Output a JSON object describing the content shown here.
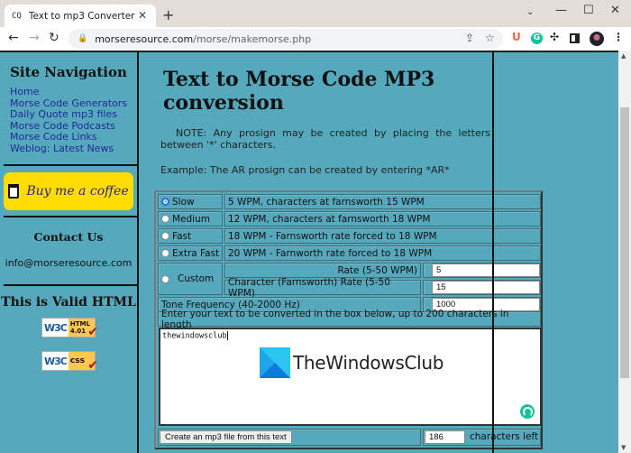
{
  "browser": {
    "tab_title": "Text to mp3 Converter",
    "tab_favicon": "CQ",
    "url_host": "morseresource.com",
    "url_path": "/morse/makemorse.php",
    "extensions": [
      "U",
      "G"
    ]
  },
  "sidebar": {
    "nav_heading": "Site Navigation",
    "nav_links": [
      {
        "label": "Home"
      },
      {
        "label": "Morse Code Generators"
      },
      {
        "label": "Daily Quote mp3 files"
      },
      {
        "label": "Morse Code Podcasts"
      },
      {
        "label": "Morse Code Links"
      },
      {
        "label": "Weblog: Latest News"
      }
    ],
    "coffee_label": "Buy me a coffee",
    "contact_heading": "Contact Us",
    "contact_email": "info@morseresource.com",
    "valid_heading": "This is Valid HTML",
    "badges": [
      {
        "w3": "W3C",
        "label": "HTML 4.01"
      },
      {
        "w3": "W3C",
        "label": "css"
      }
    ]
  },
  "main": {
    "title": "Text to Morse Code MP3 conversion",
    "note": "NOTE: Any prosign may be created by placing the letters between '*' characters.",
    "example": "Example: The AR prosign can be created by entering *AR*",
    "speeds": [
      {
        "label": "Slow",
        "desc": "5 WPM, characters at farnsworth 15 WPM",
        "selected": true
      },
      {
        "label": "Medium",
        "desc": "12 WPM, characters at farnsworth 18 WPM",
        "selected": false
      },
      {
        "label": "Fast",
        "desc": "18 WPM - Farnsworth rate forced to 18 WPM",
        "selected": false
      },
      {
        "label": "Extra Fast",
        "desc": "20 WPM - Farnworth rate forced to 18 WPM",
        "selected": false
      }
    ],
    "custom": {
      "label": "Custom",
      "rate_label": "Rate (5-50 WPM)",
      "rate_value": "5",
      "char_rate_label": "Character (Farnsworth) Rate (5-50 WPM)",
      "char_rate_value": "15"
    },
    "tone_label": "Tone Frequency (40-2000 Hz)",
    "tone_value": "1000",
    "text_instructions": "Enter your text to be converted in the box below, up to 200 characters in length",
    "text_value": "thewindowsclub",
    "watermark": "TheWindowsClub",
    "submit_label": "Create an mp3 file from this text",
    "chars_left_value": "186",
    "chars_left_label": "characters left"
  }
}
